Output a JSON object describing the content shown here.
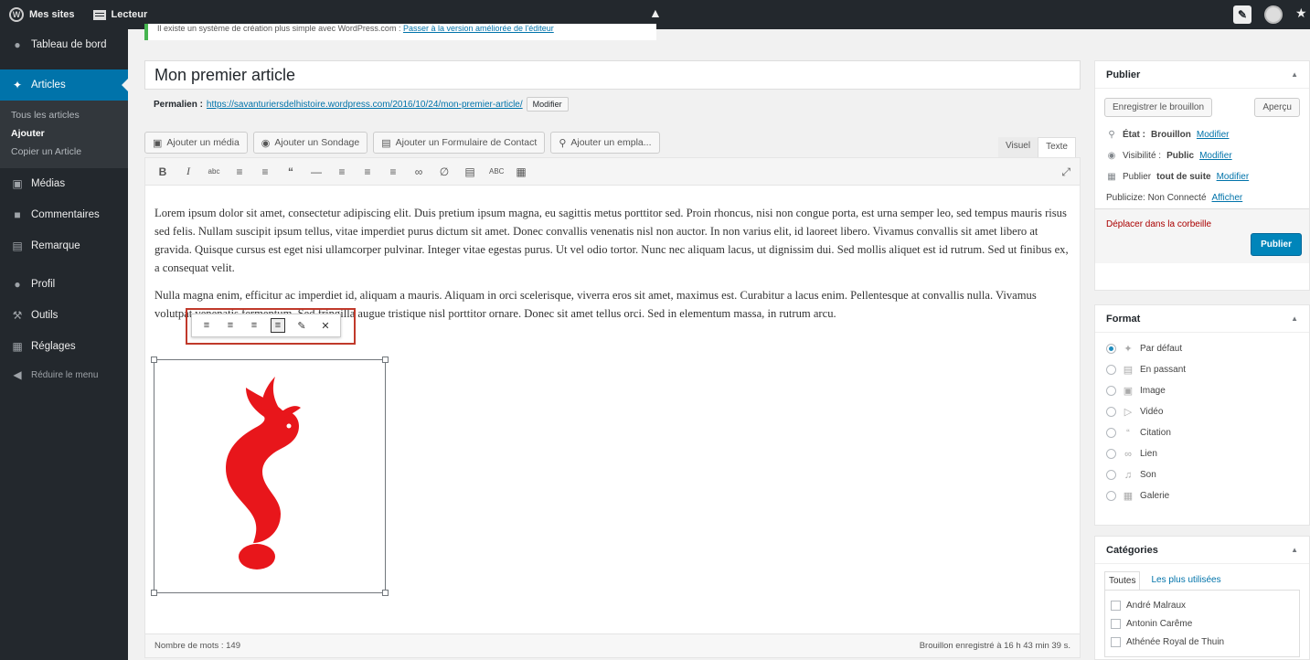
{
  "adminbar": {
    "my_sites": "Mes sites",
    "reader": "Lecteur",
    "center_icon": "collapse-arrow-icon"
  },
  "sidebar": {
    "dashboard": "Tableau de bord",
    "articles": "Articles",
    "submenu": [
      "Tous les articles",
      "Ajouter",
      "Copier un Article"
    ],
    "media": "Médias",
    "comments": "Commentaires",
    "feedback": "Remarque",
    "profile": "Profil",
    "tools": "Outils",
    "settings": "Réglages",
    "collapse": "Réduire le menu"
  },
  "notice": {
    "text": "Il existe un système de création plus simple avec WordPress.com : ",
    "link": "Passer à la version améliorée de l'éditeur"
  },
  "post": {
    "title": "Mon premier article",
    "permalink_label": "Permalien :",
    "permalink_url": "https://savanturiersdelhistoire.wordpress.com/2016/10/24/mon-premier-article/",
    "permalink_edit": "Modifier"
  },
  "media_buttons": [
    "Ajouter un média",
    "Ajouter un Sondage",
    "Ajouter un Formulaire de Contact",
    "Ajouter un empla..."
  ],
  "editor_tabs": {
    "visual": "Visuel",
    "text": "Texte"
  },
  "content": {
    "p1": "Lorem ipsum dolor sit amet, consectetur adipiscing elit. Duis pretium ipsum magna, eu sagittis metus porttitor sed. Proin rhoncus, nisi non congue porta, est urna semper leo, sed tempus mauris risus sed felis. Nullam suscipit ipsum tellus, vitae imperdiet purus dictum sit amet. Donec convallis venenatis nisl non auctor. In non varius elit, id laoreet libero. Vivamus convallis sit amet libero at gravida. Quisque cursus est eget nisi ullamcorper pulvinar. Integer vitae egestas purus. Ut vel odio tortor. Nunc nec aliquam lacus, ut dignissim dui. Sed mollis aliquet est id rutrum. Sed ut finibus ex, a consequat velit.",
    "p2": "Nulla magna enim, efficitur ac imperdiet id, aliquam a mauris. Aliquam in orci scelerisque, viverra eros sit amet, maximus est. Curabitur a lacus enim. Pellentesque at convallis nulla. Vivamus volutpat venenatis fermentum. Sed fringilla augue tristique nisl porttitor ornare. Donec sit amet tellus orci. Sed in elementum massa, in rutrum arcu."
  },
  "editor_status": {
    "word_count": "Nombre de mots : 149",
    "draft_saved": "Brouillon enregistré à 16 h 43 min 39 s."
  },
  "publish": {
    "title": "Publier",
    "save_draft": "Enregistrer le brouillon",
    "preview": "Aperçu",
    "status_label": "État :",
    "status_value": "Brouillon",
    "visibility_label": "Visibilité :",
    "visibility_value": "Public",
    "schedule_label": "Publier",
    "schedule_value": "tout de suite",
    "edit": "Modifier",
    "publicize": "Publicize: Non Connecté",
    "publicize_link": "Afficher",
    "trash": "Déplacer dans la corbeille",
    "publish_button": "Publier"
  },
  "format": {
    "title": "Format",
    "options": [
      {
        "label": "Par défaut",
        "icon": "pin-icon"
      },
      {
        "label": "En passant",
        "icon": "aside-icon"
      },
      {
        "label": "Image",
        "icon": "image-icon"
      },
      {
        "label": "Vidéo",
        "icon": "video-icon"
      },
      {
        "label": "Citation",
        "icon": "quote-icon"
      },
      {
        "label": "Lien",
        "icon": "link-icon"
      },
      {
        "label": "Son",
        "icon": "audio-icon"
      },
      {
        "label": "Galerie",
        "icon": "gallery-icon"
      }
    ],
    "selected": "Par défaut"
  },
  "categories": {
    "title": "Catégories",
    "tab_all": "Toutes",
    "tab_popular": "Les plus utilisées",
    "items": [
      "André Malraux",
      "Antonin Carême",
      "Athénée Royal de Thuin"
    ]
  },
  "colors": {
    "accent": "#0073aa",
    "image_mark": "#e8161b",
    "highlight_box": "#c0392b",
    "admin_bar": "#23282d"
  }
}
